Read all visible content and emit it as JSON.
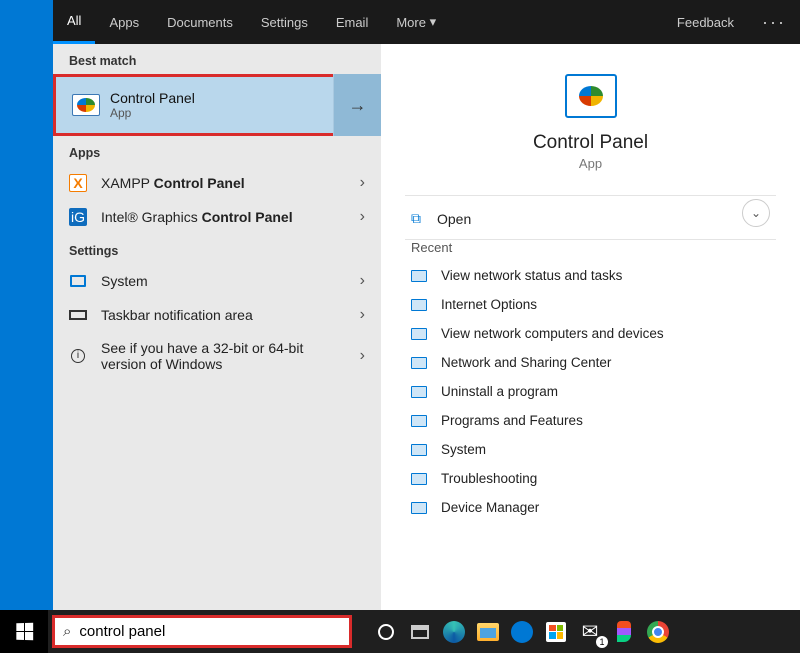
{
  "tabs": {
    "all": "All",
    "apps": "Apps",
    "documents": "Documents",
    "settings": "Settings",
    "email": "Email",
    "more": "More",
    "feedback": "Feedback"
  },
  "sections": {
    "best_match": "Best match",
    "apps": "Apps",
    "settings": "Settings",
    "recent": "Recent"
  },
  "best_match": {
    "title": "Control Panel",
    "subtitle": "App"
  },
  "apps_list": {
    "xampp_prefix": "XAMPP ",
    "xampp_bold": "Control Panel",
    "intel_prefix": "Intel® Graphics ",
    "intel_bold": "Control Panel"
  },
  "settings_list": {
    "system": "System",
    "taskbar": "Taskbar notification area",
    "bits": "See if you have a 32-bit or 64-bit version of Windows"
  },
  "preview": {
    "title": "Control Panel",
    "subtitle": "App",
    "open": "Open"
  },
  "recent": {
    "r0": "View network status and tasks",
    "r1": "Internet Options",
    "r2": "View network computers and devices",
    "r3": "Network and Sharing Center",
    "r4": "Uninstall a program",
    "r5": "Programs and Features",
    "r6": "System",
    "r7": "Troubleshooting",
    "r8": "Device Manager"
  },
  "search": {
    "value": "control panel"
  },
  "mail_badge": "1"
}
